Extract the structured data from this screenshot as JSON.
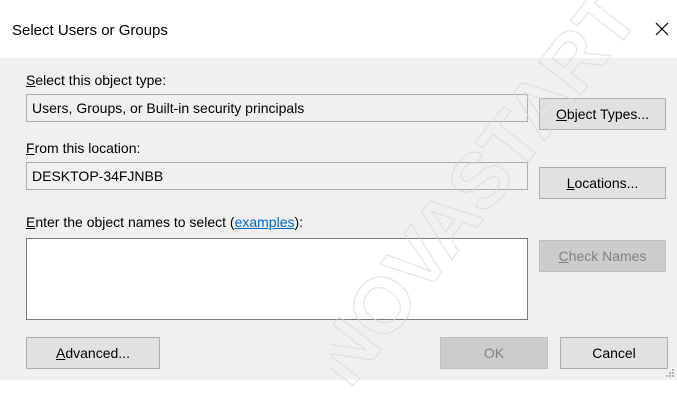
{
  "window": {
    "title": "Select Users or Groups"
  },
  "object_type": {
    "label_accel": "S",
    "label_rest": "elect this object type:",
    "value": "Users, Groups, or Built-in security principals",
    "button_accel": "O",
    "button_rest": "bject Types..."
  },
  "location": {
    "label_accel": "F",
    "label_rest": "rom this location:",
    "value": "DESKTOP-34FJNBB",
    "button_accel": "L",
    "button_rest": "ocations..."
  },
  "names": {
    "label_accel": "E",
    "label_rest": "nter the object names to select (",
    "link": "examples",
    "label_end": "):",
    "value": "",
    "check_accel": "C",
    "check_rest": "heck Names"
  },
  "footer": {
    "advanced_accel": "A",
    "advanced_rest": "dvanced...",
    "ok": "OK",
    "cancel": "Cancel"
  },
  "watermark_text": "NOVASTART"
}
